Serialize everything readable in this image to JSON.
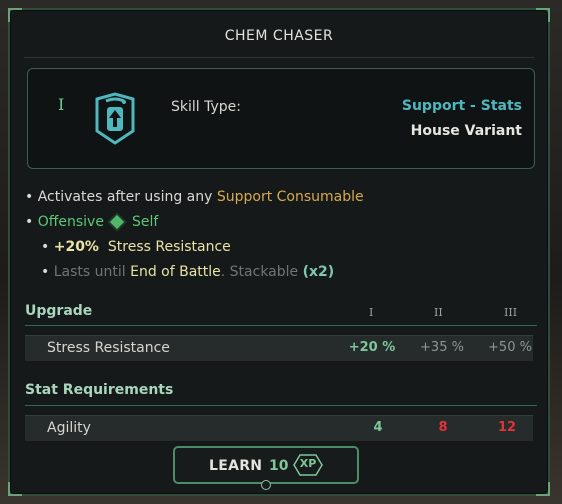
{
  "window": {
    "title": "CHEM CHASER"
  },
  "skill": {
    "rank_mark": "I",
    "icon": "chemical-flask-arrow-icon",
    "type_label": "Skill Type:",
    "type_value": "Support - Stats",
    "variant": "House Variant"
  },
  "description": {
    "line1_prefix": "• Activates after using any ",
    "line1_highlight": "Support Consumable",
    "line2_bullet": "• ",
    "line2_target": "Offensive",
    "line2_icon": "green-diamond-icon",
    "line2_self": "Self",
    "line3_bullet": "• ",
    "line3_value": "+20%",
    "line3_stat": "Stress Resistance",
    "line4_bullet": "• ",
    "line4_prefix": "Lasts until ",
    "line4_duration": "End of Battle",
    "line4_sep": ". Stackable ",
    "line4_stack": "(x2)"
  },
  "upgrade": {
    "header": "Upgrade",
    "ranks": [
      "I",
      "II",
      "III"
    ],
    "rows": [
      {
        "label": "Stress Resistance",
        "values": [
          "+20 %",
          "+35 %",
          "+50 %"
        ]
      }
    ]
  },
  "requirements": {
    "header": "Stat Requirements",
    "rows": [
      {
        "label": "Agility",
        "values": [
          "4",
          "8",
          "12"
        ]
      }
    ]
  },
  "learn": {
    "label": "LEARN",
    "cost": "10",
    "currency": "XP"
  },
  "colors": {
    "accent_green": "#5cc879",
    "accent_teal": "#4fb7be",
    "highlight_orange": "#d9a94f",
    "requirement_met": "#7fc79a",
    "requirement_unmet": "#e0333a"
  }
}
